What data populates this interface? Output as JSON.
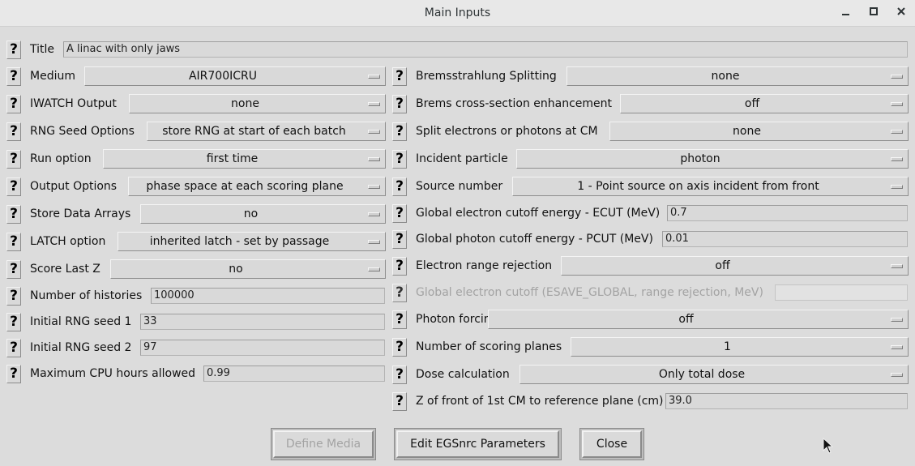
{
  "window": {
    "title": "Main Inputs",
    "minimize_icon": "minimize-icon",
    "maximize_icon": "maximize-icon",
    "close_icon": "close-icon"
  },
  "help_glyph": "?",
  "title_row": {
    "label": "Title",
    "value": "A linac with only jaws"
  },
  "left": {
    "medium": {
      "label": "Medium",
      "value": "AIR700ICRU"
    },
    "iwatch": {
      "label": "IWATCH Output",
      "value": "none"
    },
    "rng_seed_options": {
      "label": "RNG Seed Options",
      "value": "store RNG at start of each batch"
    },
    "run_option": {
      "label": "Run option",
      "value": "first time"
    },
    "output_options": {
      "label": "Output Options",
      "value": "phase space at each scoring plane"
    },
    "store_data_arrays": {
      "label": "Store Data Arrays",
      "value": "no"
    },
    "latch_option": {
      "label": "LATCH option",
      "value": "inherited latch - set by passage"
    },
    "score_last_z": {
      "label": "Score Last Z",
      "value": "no"
    },
    "number_of_histories": {
      "label": "Number of histories",
      "value": "100000"
    },
    "rng_seed_1": {
      "label": "Initial RNG seed 1",
      "value": "33"
    },
    "rng_seed_2": {
      "label": "Initial RNG seed 2",
      "value": "97"
    },
    "max_cpu_hours": {
      "label": "Maximum CPU hours allowed",
      "value": "0.99"
    }
  },
  "right": {
    "brems_splitting": {
      "label": "Bremsstrahlung Splitting",
      "value": "none"
    },
    "brems_xsec": {
      "label": "Brems cross-section enhancement",
      "value": "off"
    },
    "split_at_cm": {
      "label": "Split electrons or photons at CM",
      "value": "none"
    },
    "incident_particle": {
      "label": "Incident particle",
      "value": "photon"
    },
    "source_number": {
      "label": "Source number",
      "value": "1 - Point source on axis incident from front"
    },
    "ecut": {
      "label": "Global electron cutoff energy - ECUT (MeV)",
      "value": "0.7"
    },
    "pcut": {
      "label": "Global photon cutoff energy - PCUT (MeV)",
      "value": "0.01"
    },
    "range_rejection": {
      "label": "Electron range rejection",
      "value": "off"
    },
    "esave_global": {
      "label": "Global electron cutoff (ESAVE_GLOBAL, range rejection, MeV)",
      "value": ""
    },
    "photon_forcing": {
      "label": "Photon forcing",
      "value": "off"
    },
    "scoring_planes": {
      "label": "Number of scoring planes",
      "value": "1"
    },
    "dose_calculation": {
      "label": "Dose calculation",
      "value": "Only total dose"
    },
    "z_front_cm": {
      "label": "Z of front of 1st CM to reference plane (cm)",
      "value": "39.0"
    }
  },
  "buttons": {
    "define_media": "Define Media",
    "edit_egsnrc": "Edit EGSnrc Parameters",
    "close": "Close"
  }
}
